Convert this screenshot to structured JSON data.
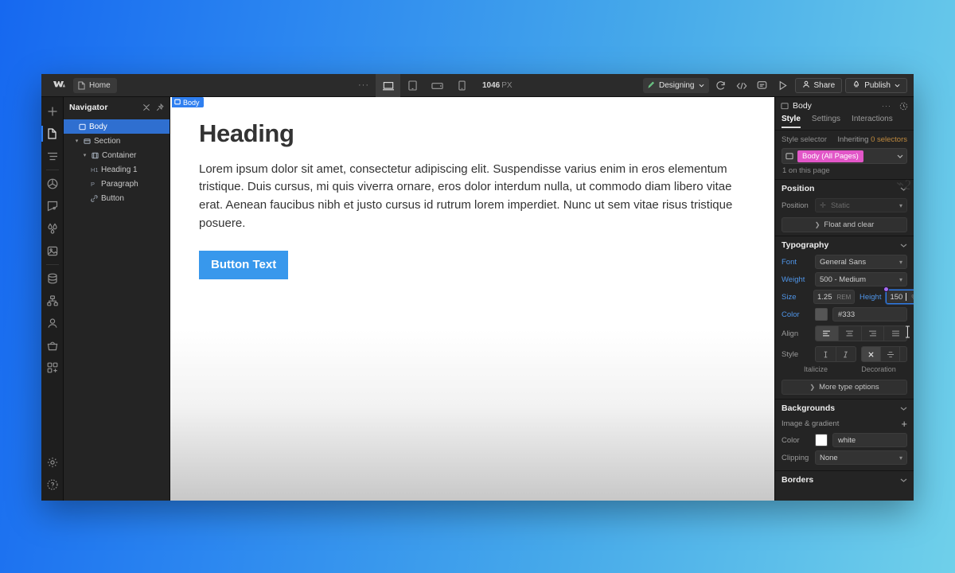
{
  "app": {
    "title": "Webflow Designer",
    "logo_icon": "webflow-logo-icon"
  },
  "topbar": {
    "page_chip": {
      "label": "Home",
      "icon": "page-icon"
    },
    "overflow_dots": "···",
    "breakpoints": [
      {
        "name": "desktop",
        "icon": "desktop-icon",
        "active": true
      },
      {
        "name": "tablet",
        "icon": "tablet-icon",
        "active": false
      },
      {
        "name": "mobile-landscape",
        "icon": "mobile-landscape-icon",
        "active": false
      },
      {
        "name": "mobile-portrait",
        "icon": "mobile-portrait-icon",
        "active": false
      }
    ],
    "canvas_size": "1046",
    "canvas_size_unit": "PX",
    "mode": {
      "label": "Designing",
      "icon": "pen-icon",
      "chevron": "chevron-down-icon"
    },
    "icons": [
      {
        "name": "refresh-icon"
      },
      {
        "name": "code-icon"
      },
      {
        "name": "comment-icon"
      },
      {
        "name": "preview-play-icon"
      }
    ],
    "share_label": "Share",
    "publish_label": "Publish"
  },
  "rail": {
    "items": [
      {
        "name": "add-elements",
        "icon": "plus-icon",
        "active": false
      },
      {
        "name": "pages",
        "icon": "page-icon",
        "active": true
      },
      {
        "name": "navigator",
        "icon": "navigator-icon",
        "active": false
      },
      {
        "name": "components",
        "icon": "cube-icon",
        "active": false
      },
      {
        "name": "style-manager",
        "icon": "paint-icon",
        "active": false
      },
      {
        "name": "variables",
        "icon": "droplets-icon",
        "active": false
      },
      {
        "name": "assets",
        "icon": "image-icon",
        "active": false
      },
      {
        "name": "cms",
        "icon": "database-icon",
        "active": false
      },
      {
        "name": "logic",
        "icon": "logic-icon",
        "active": false
      },
      {
        "name": "users",
        "icon": "user-icon",
        "active": false
      },
      {
        "name": "ecommerce",
        "icon": "basket-icon",
        "active": false
      },
      {
        "name": "apps",
        "icon": "apps-icon",
        "active": false
      }
    ],
    "bottom": [
      {
        "name": "settings",
        "icon": "gear-icon"
      },
      {
        "name": "help",
        "icon": "help-icon"
      }
    ]
  },
  "navigator": {
    "title": "Navigator",
    "collapse_icon": "collapse-icon",
    "pin_icon": "pin-icon",
    "tree": [
      {
        "label": "Body",
        "depth": 0,
        "icon": "body-icon",
        "tag": "",
        "caret": "",
        "selected": true
      },
      {
        "label": "Section",
        "depth": 1,
        "icon": "section-icon",
        "tag": "",
        "caret": "▾",
        "selected": false
      },
      {
        "label": "Container",
        "depth": 2,
        "icon": "container-icon",
        "tag": "",
        "caret": "▾",
        "selected": false
      },
      {
        "label": "Heading 1",
        "depth": 3,
        "icon": "",
        "tag": "H1",
        "caret": "",
        "selected": false
      },
      {
        "label": "Paragraph",
        "depth": 3,
        "icon": "",
        "tag": "P",
        "caret": "",
        "selected": false
      },
      {
        "label": "Button",
        "depth": 3,
        "icon": "link-icon",
        "tag": "",
        "caret": "",
        "selected": false
      }
    ]
  },
  "canvas": {
    "badge": {
      "label": "Body",
      "icon": "body-icon"
    },
    "heading": "Heading",
    "paragraph": "Lorem ipsum dolor sit amet, consectetur adipiscing elit. Suspendisse varius enim in eros elementum tristique. Duis cursus, mi quis viverra ornare, eros dolor interdum nulla, ut commodo diam libero vitae erat. Aenean faucibus nibh et justo cursus id rutrum lorem imperdiet. Nunc ut sem vitae risus tristique posuere.",
    "button_label": "Button Text",
    "button_color": "#3898ec",
    "text_color": "#333333"
  },
  "style_panel": {
    "element_name": "Body",
    "element_icon": "body-icon",
    "more_icon": "more-dots-icon",
    "refresh_icon": "sync-icon",
    "tabs": [
      {
        "label": "Style",
        "active": true
      },
      {
        "label": "Settings",
        "active": false
      },
      {
        "label": "Interactions",
        "active": false
      }
    ],
    "selector": {
      "label": "Style selector",
      "inheriting_prefix": "Inheriting",
      "inheriting_value": "0 selectors",
      "class_name": "Body (All Pages)",
      "class_color": "#e256c8",
      "usage": "1 on this page",
      "element_icon": "body-icon",
      "chevron": "chevron-down-icon"
    },
    "position": {
      "title": "Position",
      "position_label": "Position",
      "position_value": "Static",
      "float_clear": "Float and clear"
    },
    "typography": {
      "title": "Typography",
      "font_label": "Font",
      "font_value": "General Sans",
      "weight_label": "Weight",
      "weight_value": "500 - Medium",
      "size_label": "Size",
      "size_value": "1.25",
      "size_unit": "REM",
      "height_label": "Height",
      "height_value": "150",
      "height_unit": "%",
      "color_label": "Color",
      "color_value": "#333",
      "align_label": "Align",
      "align_options": [
        {
          "name": "align-left-icon",
          "active": true
        },
        {
          "name": "align-center-icon",
          "active": false
        },
        {
          "name": "align-right-icon",
          "active": false
        },
        {
          "name": "align-justify-icon",
          "active": false
        }
      ],
      "style_label": "Style",
      "italicize_options": [
        {
          "name": "upright-icon",
          "active": false
        },
        {
          "name": "italic-icon",
          "active": false
        }
      ],
      "decoration_options": [
        {
          "name": "no-decoration-icon",
          "active": true
        },
        {
          "name": "strikethrough-icon",
          "active": false
        },
        {
          "name": "underline-icon",
          "active": false
        },
        {
          "name": "overline-icon",
          "active": false
        }
      ],
      "italicize_sublabel": "Italicize",
      "decoration_sublabel": "Decoration",
      "more_options": "More type options"
    },
    "backgrounds": {
      "title": "Backgrounds",
      "image_gradient_label": "Image & gradient",
      "add_icon": "plus-icon",
      "color_label": "Color",
      "color_value": "white",
      "clipping_label": "Clipping",
      "clipping_value": "None"
    },
    "borders": {
      "title": "Borders"
    }
  }
}
